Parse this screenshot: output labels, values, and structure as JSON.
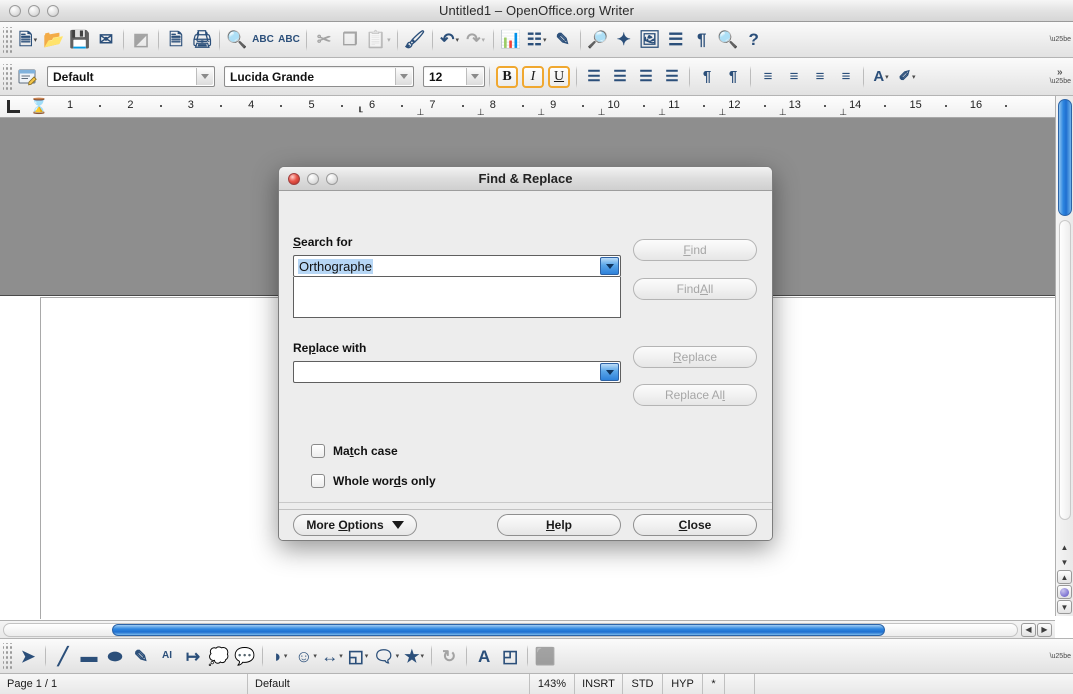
{
  "window": {
    "title": "Untitled1 – OpenOffice.org Writer",
    "traffic_lights": [
      "close-button",
      "minimize-button",
      "zoom-button"
    ]
  },
  "toolbar_main": {
    "items": [
      {
        "name": "new-document-icon",
        "glyph": "🗎",
        "dim": false,
        "caret": true
      },
      {
        "name": "open-document-icon",
        "glyph": "📂",
        "dim": false,
        "caret": false
      },
      {
        "name": "save-document-icon",
        "glyph": "💾",
        "dim": false,
        "caret": false
      },
      {
        "name": "send-email-icon",
        "glyph": "✉",
        "dim": false,
        "caret": false
      },
      {
        "name": "edit-file-icon",
        "glyph": "◩",
        "dim": true,
        "caret": false
      },
      {
        "name": "export-pdf-icon",
        "glyph": "🗎",
        "dim": false,
        "caret": false
      },
      {
        "name": "print-file-icon",
        "glyph": "🖨",
        "dim": false,
        "caret": false
      },
      {
        "name": "page-preview-icon",
        "glyph": "🔍",
        "dim": false,
        "caret": false
      },
      {
        "name": "spelling-check-icon",
        "glyph": "ABC",
        "dim": false,
        "caret": false
      },
      {
        "name": "autospellcheck-icon",
        "glyph": "ABC",
        "dim": false,
        "caret": false
      },
      {
        "name": "cut-icon",
        "glyph": "✂",
        "dim": true,
        "caret": false
      },
      {
        "name": "copy-icon",
        "glyph": "❐",
        "dim": true,
        "caret": false
      },
      {
        "name": "paste-icon",
        "glyph": "📋",
        "dim": true,
        "caret": true
      },
      {
        "name": "clone-formatting-icon",
        "glyph": "🖌",
        "dim": false,
        "caret": false
      },
      {
        "name": "undo-icon",
        "glyph": "↶",
        "dim": false,
        "caret": true
      },
      {
        "name": "redo-icon",
        "glyph": "↷",
        "dim": true,
        "caret": true
      },
      {
        "name": "insert-chart-icon",
        "glyph": "📊",
        "dim": false,
        "caret": false
      },
      {
        "name": "insert-table-icon",
        "glyph": "☷",
        "dim": false,
        "caret": true
      },
      {
        "name": "show-draw-functions-icon",
        "glyph": "✎",
        "dim": false,
        "caret": false
      },
      {
        "name": "find-and-replace-icon",
        "glyph": "🔎",
        "dim": false,
        "caret": false
      },
      {
        "name": "insert-special-character-icon",
        "glyph": "✦",
        "dim": false,
        "caret": false
      },
      {
        "name": "gallery-icon",
        "glyph": "🖼",
        "dim": false,
        "caret": false
      },
      {
        "name": "navigator-icon",
        "glyph": "☰",
        "dim": false,
        "caret": false
      },
      {
        "name": "formatting-marks-icon",
        "glyph": "¶",
        "dim": false,
        "caret": false
      },
      {
        "name": "zoom-icon",
        "glyph": "🔍",
        "dim": false,
        "caret": false
      },
      {
        "name": "help-icon",
        "glyph": "?",
        "dim": false,
        "caret": false
      }
    ]
  },
  "toolbar_format": {
    "paragraph_style_icon": "paragraph-style-icon",
    "style": {
      "value": "Default"
    },
    "font": {
      "value": "Lucida Grande"
    },
    "size": {
      "value": "12"
    },
    "bold_label": "B",
    "italic_label": "I",
    "underline_label": "U",
    "align_icons": [
      {
        "name": "align-left-icon",
        "glyph": "☰"
      },
      {
        "name": "align-center-icon",
        "glyph": "☰"
      },
      {
        "name": "align-right-icon",
        "glyph": "☰"
      },
      {
        "name": "align-justified-icon",
        "glyph": "☰"
      }
    ],
    "direction_icons": [
      {
        "name": "ltr-paragraph-icon",
        "glyph": "¶"
      },
      {
        "name": "rtl-paragraph-icon",
        "glyph": "¶"
      }
    ],
    "list_icons": [
      {
        "name": "ordered-list-icon",
        "glyph": "≡"
      },
      {
        "name": "unordered-list-icon",
        "glyph": "≡"
      },
      {
        "name": "decrease-indent-icon",
        "glyph": "≡"
      },
      {
        "name": "increase-indent-icon",
        "glyph": "≡"
      }
    ],
    "color_icons": [
      {
        "name": "font-color-icon",
        "glyph": "A",
        "caret": true
      },
      {
        "name": "highlighting-icon",
        "glyph": "✐",
        "caret": true
      }
    ],
    "overflow_label": "»"
  },
  "ruler": {
    "tab-stop-icon": "L",
    "indent-marker-icon": "⧗",
    "numbers": [
      1,
      2,
      3,
      4,
      5,
      6,
      7,
      8,
      9,
      10,
      11,
      12,
      13,
      14,
      15,
      16
    ],
    "tab_marks": [
      "┖",
      "⊥",
      "⊥",
      "⊥",
      "⊥",
      "⊥",
      "⊥",
      "⊥",
      "⊥"
    ]
  },
  "scrollbars": {
    "vertical": {
      "name": "vertical-scrollbar"
    },
    "horizontal": {
      "name": "horizontal-scrollbar"
    },
    "nav_buttons": [
      {
        "name": "scroll-up-arrow",
        "glyph": "▲"
      },
      {
        "name": "scroll-down-arrow",
        "glyph": "▼"
      },
      {
        "name": "previous-page-button",
        "glyph": "▲"
      },
      {
        "name": "navigation-button",
        "glyph": "●"
      },
      {
        "name": "next-page-button",
        "glyph": "▼"
      }
    ]
  },
  "toolbar_draw": {
    "items": [
      {
        "name": "select-tool-icon",
        "glyph": "➤"
      },
      {
        "name": "line-tool-icon",
        "glyph": "╱"
      },
      {
        "name": "rectangle-tool-icon",
        "glyph": "▬"
      },
      {
        "name": "ellipse-tool-icon",
        "glyph": "⬬"
      },
      {
        "name": "freeform-line-tool-icon",
        "glyph": "✎"
      },
      {
        "name": "fontwork-tool-icon",
        "glyph": "AI"
      },
      {
        "name": "dimension-line-icon",
        "glyph": "↦"
      },
      {
        "name": "callout-tool-icon",
        "glyph": "💭"
      },
      {
        "name": "text-callout-icon",
        "glyph": "💬"
      },
      {
        "name": "basic-shapes-icon",
        "glyph": "◗",
        "caret": true
      },
      {
        "name": "symbol-shapes-icon",
        "glyph": "☺",
        "caret": true
      },
      {
        "name": "block-arrows-icon",
        "glyph": "↔",
        "caret": true
      },
      {
        "name": "flowchart-shapes-icon",
        "glyph": "◱",
        "caret": true
      },
      {
        "name": "callout-shapes-icon",
        "glyph": "🗨",
        "caret": true
      },
      {
        "name": "stars-shapes-icon",
        "glyph": "★",
        "caret": true
      },
      {
        "name": "rotate-tool-icon",
        "glyph": "↻",
        "dim": true
      },
      {
        "name": "text-box-icon",
        "glyph": "A"
      },
      {
        "name": "gallery-toggle-icon",
        "glyph": "◰"
      },
      {
        "name": "extrusion-toggle-icon",
        "glyph": "⬛",
        "dim": true
      }
    ]
  },
  "statusbar": {
    "page": "Page 1 / 1",
    "page_style": "Default",
    "zoom": "143%",
    "insert_mode": "INSRT",
    "selection_mode": "STD",
    "hyperlink_mode": "HYP",
    "modified": "*"
  },
  "dialog": {
    "title": "Find & Replace",
    "traffic_lights": [
      "close-button",
      "minimize-button",
      "zoom-button"
    ],
    "search_label": "Search for",
    "search_label_accel": "S",
    "search_value": "Orthographe",
    "replace_label": "Replace with",
    "replace_label_accel": "p",
    "replace_value": "",
    "buttons": {
      "find": {
        "label": "Find",
        "accel": "F",
        "enabled": false
      },
      "find_all": {
        "label": "Find All",
        "accel": "A",
        "enabled": false
      },
      "replace": {
        "label": "Replace",
        "accel": "R",
        "enabled": false
      },
      "replace_all": {
        "label": "Replace All",
        "accel": "l",
        "enabled": false
      },
      "more_options": {
        "label": "More Options",
        "accel": "O",
        "enabled": true
      },
      "help": {
        "label": "Help",
        "accel": "H",
        "enabled": true
      },
      "close": {
        "label": "Close",
        "accel": "C",
        "enabled": true
      }
    },
    "checkboxes": [
      {
        "name": "match-case-checkbox",
        "label": "Match case",
        "checked": false
      },
      {
        "name": "whole-words-only-checkbox",
        "label": "Whole words only",
        "checked": false
      }
    ]
  },
  "colors": {
    "aqua_blue": "#2e86e0",
    "selection_blue": "#b6d6f5",
    "toolbar_gray": "#ededed",
    "canvas_gray": "#8e8e8e",
    "accent_orange": "#f0a830"
  }
}
